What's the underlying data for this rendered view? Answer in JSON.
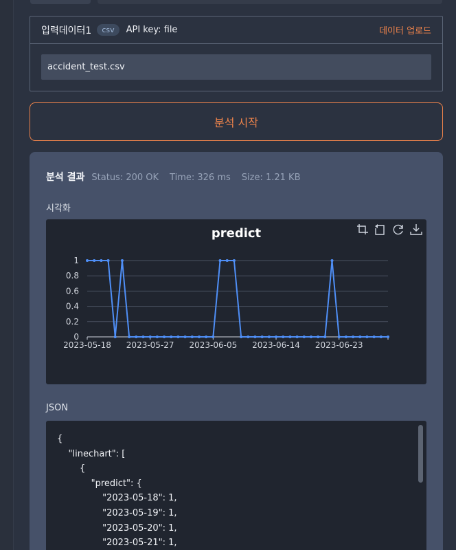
{
  "input": {
    "title": "입력데이터1",
    "badge": "csv",
    "api_key": "API key: file",
    "upload_label": "데이터 업로드",
    "file_name": "accident_test.csv"
  },
  "start_button": "분석 시작",
  "result": {
    "title": "분석 결과",
    "status": "Status: 200 OK",
    "time": "Time: 326 ms",
    "size": "Size: 1.21 KB",
    "viz_label": "시각화",
    "json_label": "JSON"
  },
  "colors": {
    "accent": "#f0844b",
    "line": "#4f8ff7"
  },
  "toolbar": [
    "crop-icon",
    "rotate-icon",
    "refresh-icon",
    "download-icon"
  ],
  "chart_data": {
    "type": "line",
    "title": "predict",
    "x": [
      "2023-05-18",
      "2023-05-19",
      "2023-05-20",
      "2023-05-21",
      "2023-05-22",
      "2023-05-23",
      "2023-05-24",
      "2023-05-25",
      "2023-05-26",
      "2023-05-27",
      "2023-05-28",
      "2023-05-29",
      "2023-05-30",
      "2023-05-31",
      "2023-06-01",
      "2023-06-02",
      "2023-06-03",
      "2023-06-04",
      "2023-06-05",
      "2023-06-06",
      "2023-06-07",
      "2023-06-08",
      "2023-06-09",
      "2023-06-10",
      "2023-06-11",
      "2023-06-12",
      "2023-06-13",
      "2023-06-14",
      "2023-06-15",
      "2023-06-16",
      "2023-06-17",
      "2023-06-18",
      "2023-06-19",
      "2023-06-20",
      "2023-06-21",
      "2023-06-22",
      "2023-06-23",
      "2023-06-24",
      "2023-06-25",
      "2023-06-26",
      "2023-06-27",
      "2023-06-28",
      "2023-06-29",
      "2023-06-30"
    ],
    "series": [
      {
        "name": "predict",
        "values": [
          1,
          1,
          1,
          1,
          0,
          1,
          0,
          0,
          0,
          0,
          0,
          0,
          0,
          0,
          0,
          0,
          0,
          0,
          0,
          1,
          1,
          1,
          0,
          0,
          0,
          0,
          0,
          0,
          0,
          0,
          0,
          0,
          0,
          0,
          0,
          1,
          0,
          0,
          0,
          0,
          0,
          0,
          0,
          0
        ]
      }
    ],
    "x_ticks": [
      "2023-05-18",
      "2023-05-27",
      "2023-06-05",
      "2023-06-14",
      "2023-06-23"
    ],
    "y_ticks": [
      "0",
      "0.2",
      "0.4",
      "0.6",
      "0.8",
      "1"
    ],
    "ylim": [
      0,
      1
    ],
    "grid": true
  },
  "json_lines": [
    "{",
    "    \"linechart\": [",
    "        {",
    "            \"predict\": {",
    "                \"2023-05-18\": 1,",
    "                \"2023-05-19\": 1,",
    "                \"2023-05-20\": 1,",
    "                \"2023-05-21\": 1,"
  ]
}
